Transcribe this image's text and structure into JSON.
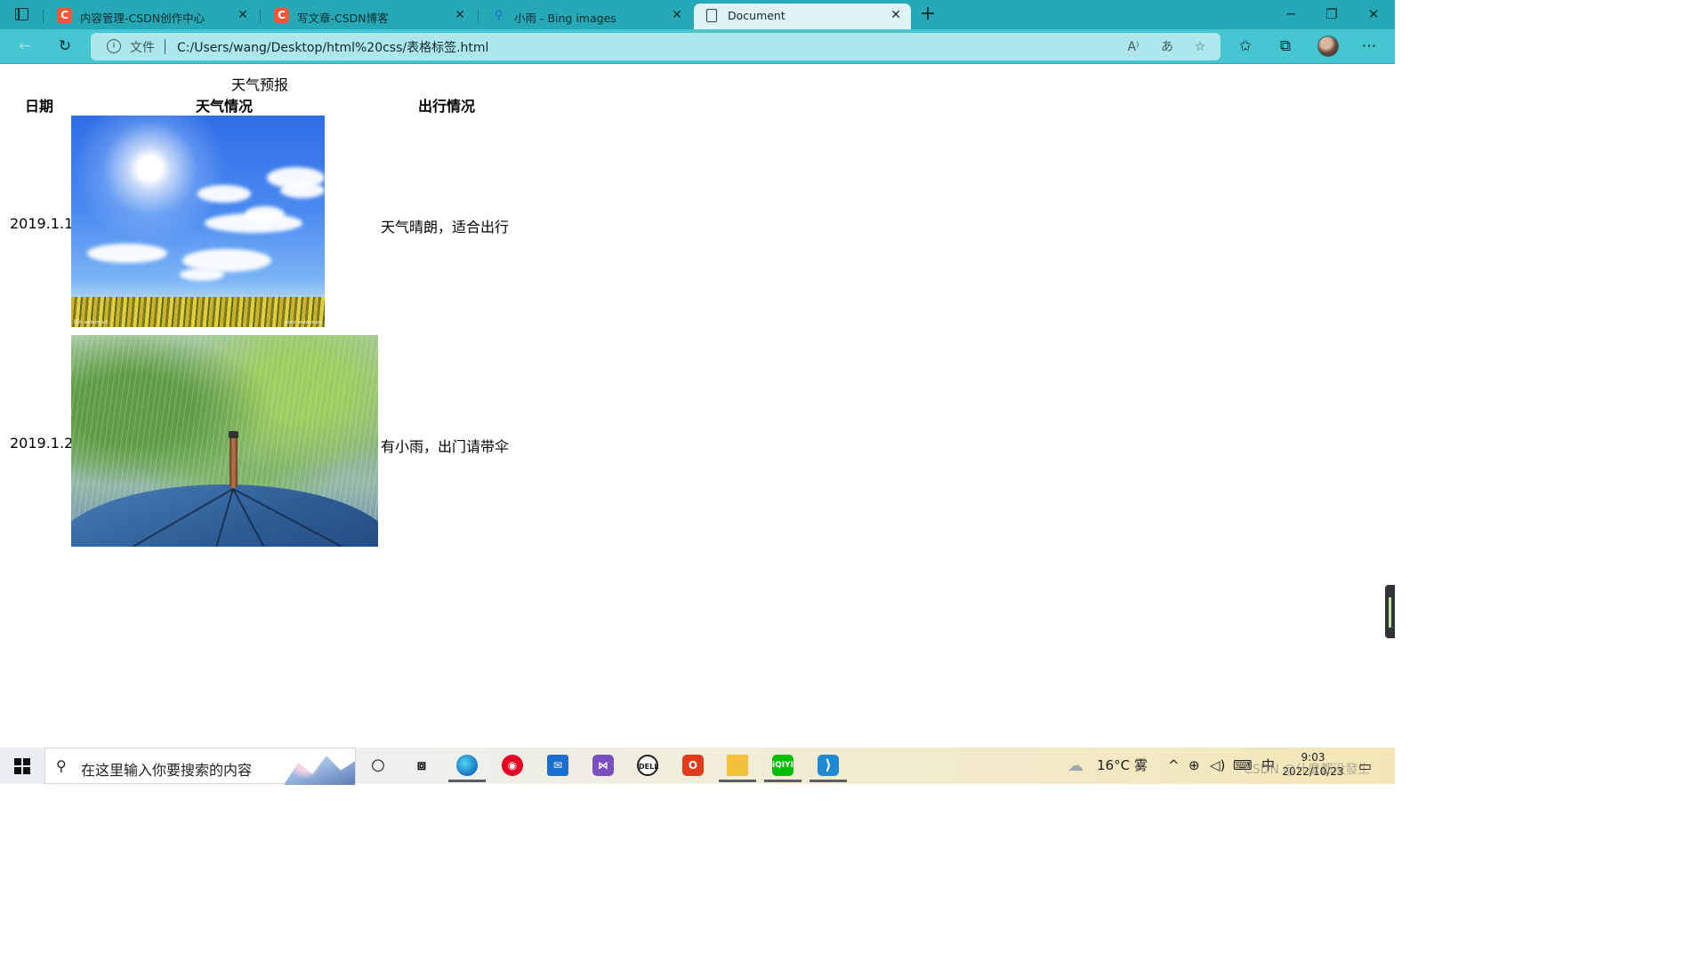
{
  "tabs": [
    {
      "title": "内容管理-CSDN创作中心",
      "favicon": "csdn-icon",
      "active": false
    },
    {
      "title": "写文章-CSDN博客",
      "favicon": "csdn-icon",
      "active": false
    },
    {
      "title": "小雨 - Bing images",
      "favicon": "search-icon",
      "active": false
    },
    {
      "title": "Document",
      "favicon": "document-icon",
      "active": true
    }
  ],
  "address_bar": {
    "scheme_label": "文件",
    "url": "C:/Users/wang/Desktop/html%20css/表格标签.html"
  },
  "page": {
    "caption": "天气预报",
    "headers": [
      "日期",
      "天气情况",
      "出行情况"
    ],
    "rows": [
      {
        "date": "2019.1.1",
        "image": "sunny-sky-over-rapeseed-field",
        "travel": "天气晴朗，适合出行"
      },
      {
        "date": "2019.1.2",
        "image": "umbrella-in-rain",
        "travel": "有小雨，出门请带伞"
      }
    ]
  },
  "taskbar": {
    "search_placeholder": "在这里输入你要搜索的内容",
    "weather": "16°C",
    "weather_desc": "雾",
    "ime": "中",
    "time": "9:03",
    "date": "2022/10/23",
    "watermark": "CSDN @什麼都没發生"
  },
  "colors": {
    "tabstrip": "#26a9b6",
    "toolbar": "#46c6d0",
    "address_bar": "#aee7eb",
    "csdn_brand": "#fc5531"
  }
}
